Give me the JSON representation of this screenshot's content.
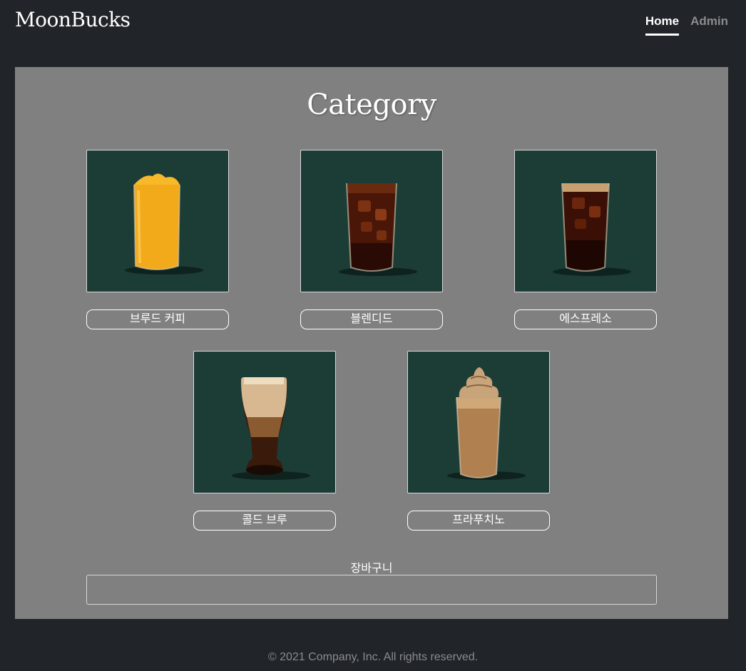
{
  "header": {
    "brand": "MoonBucks",
    "nav": [
      {
        "label": "Home",
        "active": true
      },
      {
        "label": "Admin",
        "active": false
      }
    ]
  },
  "main": {
    "title": "Category",
    "categories": [
      {
        "label": "브루드 커피",
        "icon": "mango-smoothie-drink-image"
      },
      {
        "label": "블렌디드",
        "icon": "iced-coffee-drink-image"
      },
      {
        "label": "에스프레소",
        "icon": "iced-americano-drink-image"
      },
      {
        "label": "콜드 브루",
        "icon": "cold-brew-drink-image"
      },
      {
        "label": "프라푸치노",
        "icon": "frappuccino-drink-image"
      }
    ],
    "cart_label": "장바구니",
    "cart_value": ""
  },
  "footer": {
    "text": "© 2021 Company, Inc. All rights reserved."
  },
  "colors": {
    "page_bg": "#212428",
    "panel_bg": "#808080",
    "card_bg": "#1c3c36"
  }
}
